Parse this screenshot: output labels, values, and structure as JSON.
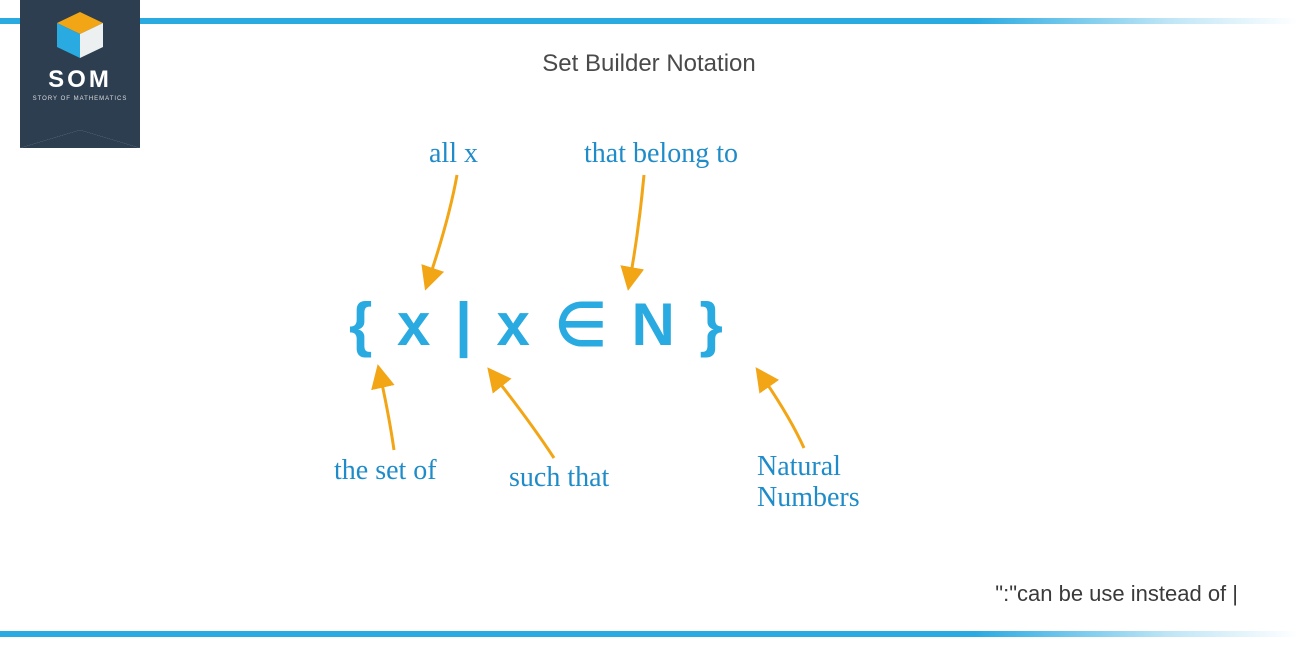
{
  "logo": {
    "text": "SOM",
    "subtitle": "STORY OF MATHEMATICS"
  },
  "title": "Set Builder Notation",
  "annotations": {
    "all_x": "all x",
    "belong_to": "that belong to",
    "set_of": "the set of",
    "such_that": "such that",
    "natural_line1": "Natural",
    "natural_line2": "Numbers"
  },
  "expression": {
    "open_brace": "{",
    "var1": "x",
    "pipe": "|",
    "var2": "x",
    "element_of": "∈",
    "set_symbol": "N",
    "close_brace": "}"
  },
  "footnote": "\":\"can be use instead of |",
  "colors": {
    "brand_blue": "#29aae1",
    "annotation_blue": "#1f8cc9",
    "arrow_orange": "#f2a515",
    "badge_dark": "#2c3e50"
  }
}
